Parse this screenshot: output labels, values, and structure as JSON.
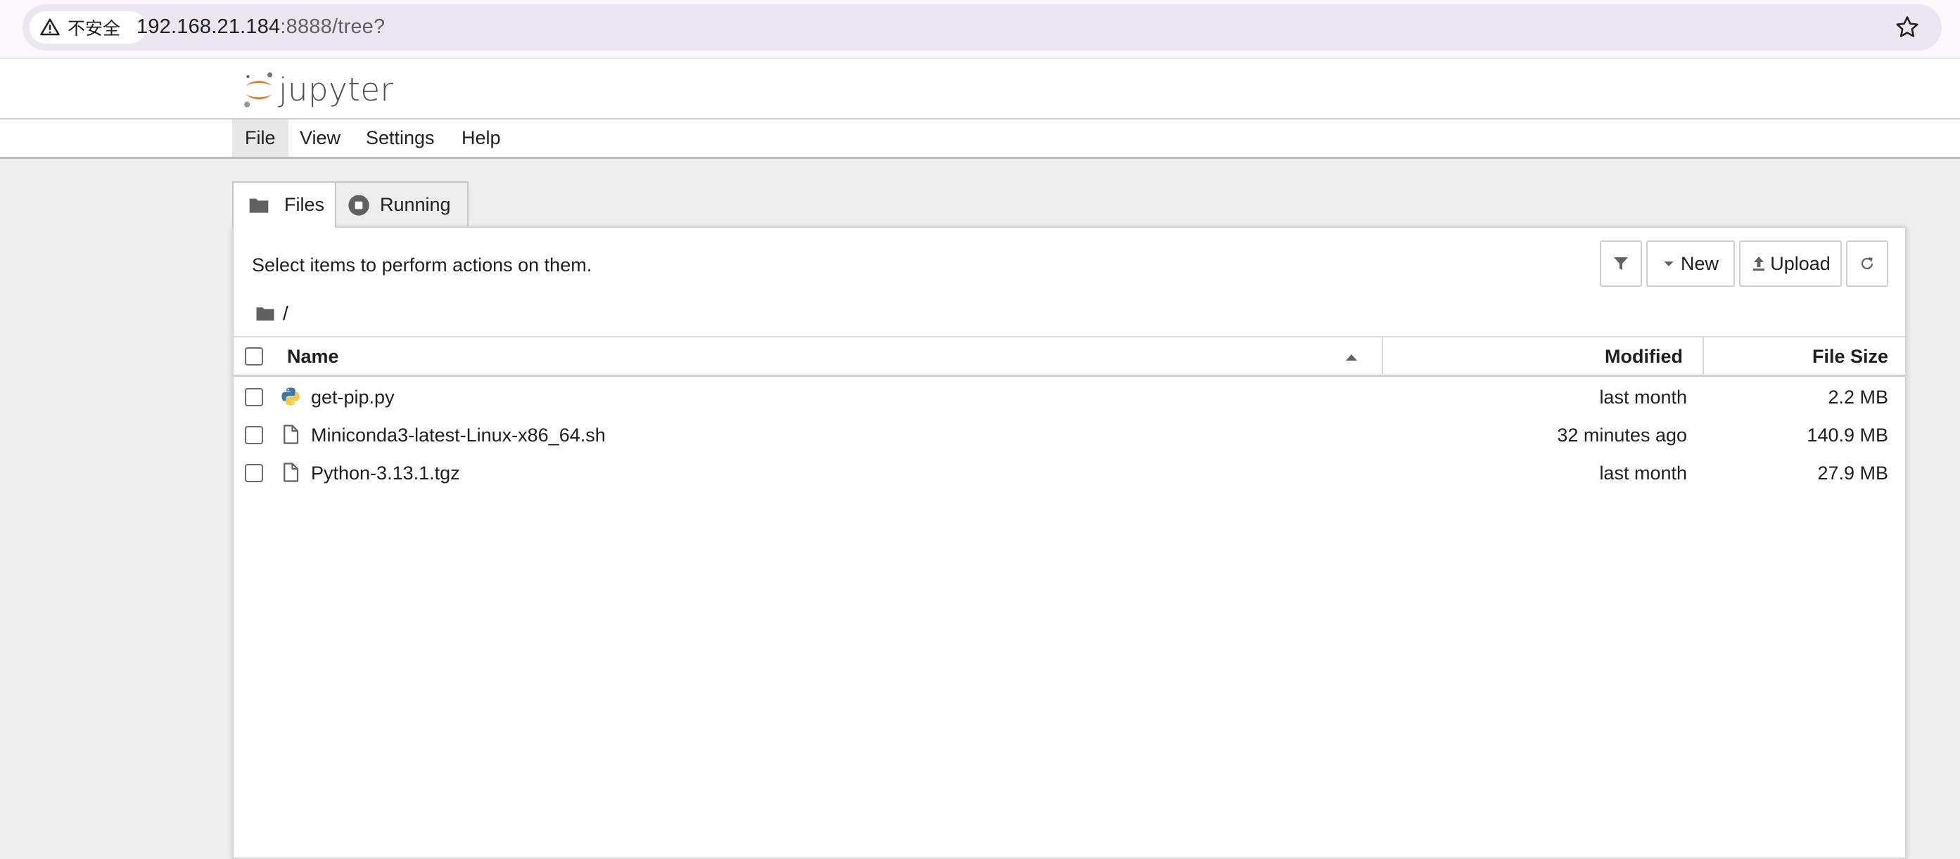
{
  "browser": {
    "security_label": "不安全",
    "url_host": "192.168.21.184",
    "url_rest": ":8888/tree?"
  },
  "app": {
    "logo_text": "jupyter"
  },
  "menu": {
    "items": [
      {
        "label": "File"
      },
      {
        "label": "View"
      },
      {
        "label": "Settings"
      },
      {
        "label": "Help"
      }
    ]
  },
  "tabs": [
    {
      "label": "Files",
      "icon": "folder-icon",
      "selected": true
    },
    {
      "label": "Running",
      "icon": "stop-circle-icon",
      "selected": false
    }
  ],
  "panel": {
    "hint": "Select items to perform actions on them.",
    "breadcrumb": "/",
    "toolbar": {
      "new_label": "New",
      "upload_label": "Upload"
    }
  },
  "table": {
    "columns": {
      "name": "Name",
      "modified": "Modified",
      "size": "File Size"
    },
    "sort": {
      "column": "name",
      "direction": "ascending"
    },
    "rows": [
      {
        "name": "get-pip.py",
        "icon": "python-icon",
        "modified": "last month",
        "size": "2.2 MB"
      },
      {
        "name": "Miniconda3-latest-Linux-x86_64.sh",
        "icon": "file-icon",
        "modified": "32 minutes ago",
        "size": "140.9 MB"
      },
      {
        "name": "Python-3.13.1.tgz",
        "icon": "file-icon",
        "modified": "last month",
        "size": "27.9 MB"
      }
    ]
  },
  "colors": {
    "accent_orange": "#f37726",
    "python_blue": "#3b77a8",
    "python_yellow": "#f6c93f"
  }
}
